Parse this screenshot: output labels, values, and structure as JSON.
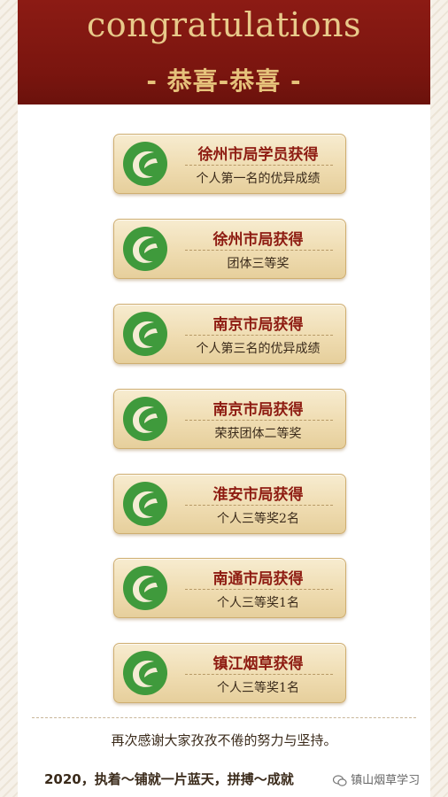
{
  "header": {
    "title": "congratulations",
    "subtitle": "- 恭喜-恭喜 -"
  },
  "awards": [
    {
      "title": "徐州市局学员获得",
      "detail": "个人第一名的优异成绩"
    },
    {
      "title": "徐州市局获得",
      "detail": "团体三等奖"
    },
    {
      "title": "南京市局获得",
      "detail": "个人第三名的优异成绩"
    },
    {
      "title": "南京市局获得",
      "detail": "荣获团体二等奖"
    },
    {
      "title": "淮安市局获得",
      "detail": "个人三等奖2名"
    },
    {
      "title": "南通市局获得",
      "detail": "个人三等奖1名"
    },
    {
      "title": "镇江烟草获得",
      "detail": "个人三等奖1名"
    }
  ],
  "logo_icon": "tobacco-leaf-c-logo",
  "colors": {
    "header_bg": "#7a150f",
    "header_text": "#e8c98a",
    "card_title": "#8e1c12",
    "logo_green": "#3f9a3c"
  },
  "closing": {
    "line1": "再次感谢大家孜孜不倦的努力与坚持。",
    "line2": "2020，执着～铺就一片蓝天，拼搏～成就"
  },
  "watermark": {
    "text": "镇山烟草学习",
    "icon": "wechat-icon"
  }
}
